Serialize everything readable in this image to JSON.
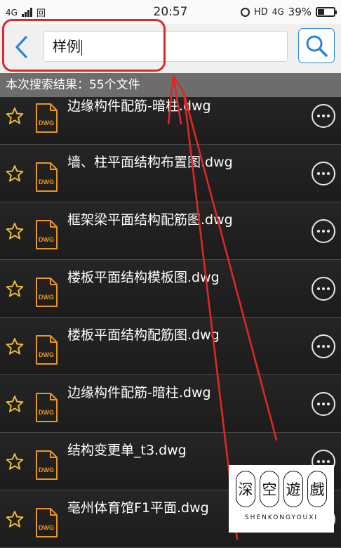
{
  "status_bar": {
    "network": "4G",
    "sim": "回",
    "time": "20:57",
    "hd": "HD",
    "network2": "4G",
    "battery_text": "39%",
    "battery_level": 0.39
  },
  "search": {
    "query": "样例",
    "back_icon": "chevron-left-icon",
    "search_icon": "magnifier-icon"
  },
  "summary": "本次搜索结果：55个文件",
  "files": [
    {
      "name": "边缘构件配筋-暗柱.dwg",
      "icon_label": "DWG"
    },
    {
      "name": "墙、柱平面结构布置图.dwg",
      "icon_label": "DWG"
    },
    {
      "name": "框架梁平面结构配筋图.dwg",
      "icon_label": "DWG"
    },
    {
      "name": "楼板平面结构模板图.dwg",
      "icon_label": "DWG"
    },
    {
      "name": "楼板平面结构配筋图.dwg",
      "icon_label": "DWG"
    },
    {
      "name": "边缘构件配筋-暗柱.dwg",
      "icon_label": "DWG"
    },
    {
      "name": "结构变更单_t3.dwg",
      "icon_label": "DWG"
    },
    {
      "name": "亳州体育馆F1平面.dwg",
      "icon_label": "DWG"
    }
  ],
  "colors": {
    "accent": "#2a84d6",
    "annotation": "#dc2828",
    "file_icon": "#e8962a"
  },
  "watermark": {
    "chars": [
      "深",
      "空",
      "遊",
      "戲"
    ],
    "sub": "SHENKONGYOUXI"
  }
}
